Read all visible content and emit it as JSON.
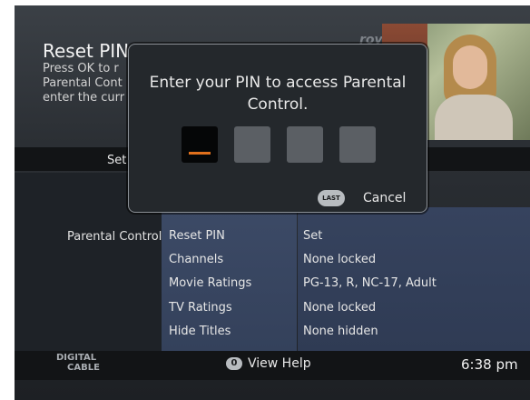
{
  "header": {
    "title": "Reset PIN",
    "description": "Press OK to r\nParental Cont\nenter the curr",
    "logo_text": "rovi"
  },
  "tabs": {
    "label": "Set"
  },
  "section": {
    "label": "Parental Control"
  },
  "rows": [
    {
      "name": "Reset PIN",
      "value": "Set"
    },
    {
      "name": "Channels",
      "value": "None locked"
    },
    {
      "name": "Movie Ratings",
      "value": "PG-13, R, NC-17, Adult"
    },
    {
      "name": "TV Ratings",
      "value": "None locked"
    },
    {
      "name": "Hide Titles",
      "value": "None hidden"
    }
  ],
  "dialog": {
    "prompt": "Enter your PIN to access Parental Control.",
    "last_key": "LAST",
    "cancel": "Cancel"
  },
  "footer": {
    "brand_line1": "DIGITAL",
    "brand_line2": "CABLE",
    "help_key": "0",
    "help_label": "View Help",
    "time": "6:38 pm"
  },
  "colors": {
    "accent": "#e0701c",
    "highlight_panel": "#3c4a66"
  }
}
